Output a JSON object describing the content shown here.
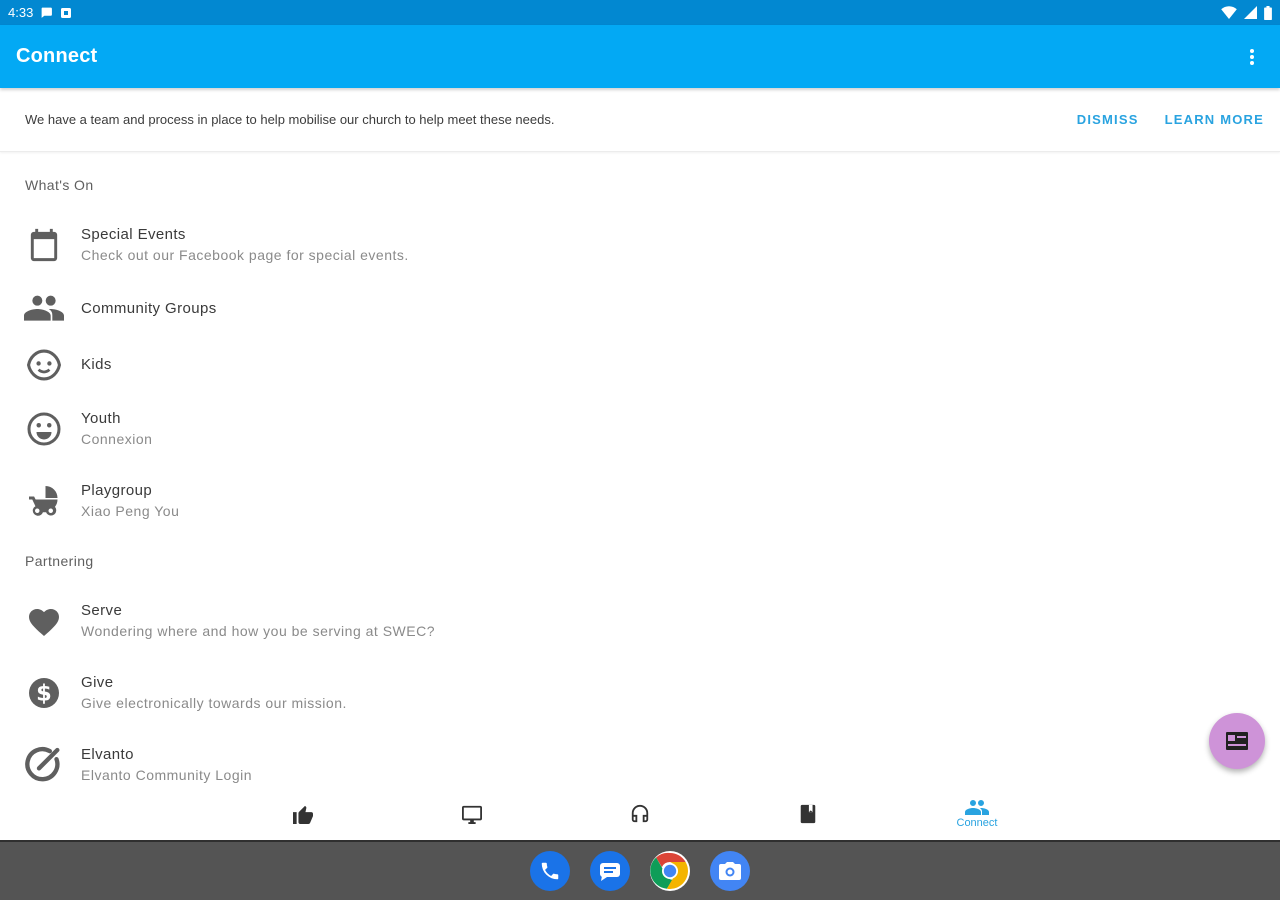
{
  "status_bar": {
    "time": "4:33",
    "left_icons": [
      "chat-bubble-icon",
      "notification-square-icon"
    ],
    "right_icons": [
      "wifi-icon",
      "signal-icon",
      "battery-icon"
    ]
  },
  "app_bar": {
    "title": "Connect",
    "overflow_icon": "more-vert-icon"
  },
  "banner": {
    "text": "We have a team and process in place to help mobilise our church to help meet these needs.",
    "dismiss_label": "DISMISS",
    "learn_more_label": "LEARN MORE"
  },
  "sections": [
    {
      "header": "What's On",
      "items": [
        {
          "icon": "calendar-icon",
          "title": "Special Events",
          "subtitle": "Check out our Facebook page for special events."
        },
        {
          "icon": "people-icon",
          "title": "Community Groups",
          "subtitle": ""
        },
        {
          "icon": "child-face-icon",
          "title": "Kids",
          "subtitle": ""
        },
        {
          "icon": "smiley-icon",
          "title": "Youth",
          "subtitle": "Connexion"
        },
        {
          "icon": "stroller-icon",
          "title": "Playgroup",
          "subtitle": "Xiao Peng You"
        }
      ]
    },
    {
      "header": "Partnering",
      "items": [
        {
          "icon": "heart-icon",
          "title": "Serve",
          "subtitle": "Wondering where and how you be serving at SWEC?"
        },
        {
          "icon": "dollar-icon",
          "title": "Give",
          "subtitle": "Give electronically towards our mission."
        },
        {
          "icon": "elvanto-check-icon",
          "title": "Elvanto",
          "subtitle": "Elvanto Community Login"
        }
      ]
    }
  ],
  "bottom_nav": [
    {
      "icon": "thumb-up-icon",
      "label": "",
      "active": false
    },
    {
      "icon": "tv-icon",
      "label": "",
      "active": false
    },
    {
      "icon": "headphones-icon",
      "label": "",
      "active": false
    },
    {
      "icon": "book-icon",
      "label": "",
      "active": false
    },
    {
      "icon": "people-icon",
      "label": "Connect",
      "active": true
    }
  ],
  "fab": {
    "icon": "card-icon"
  },
  "dock": [
    "phone-icon",
    "messages-icon",
    "chrome-icon",
    "camera-icon"
  ],
  "colors": {
    "status_bar": "#0288d1",
    "app_bar": "#03a9f4",
    "accent": "#29a3e0",
    "fab": "#ce93d8",
    "icon_grey": "#5f5f5f",
    "dock": "#545454"
  }
}
